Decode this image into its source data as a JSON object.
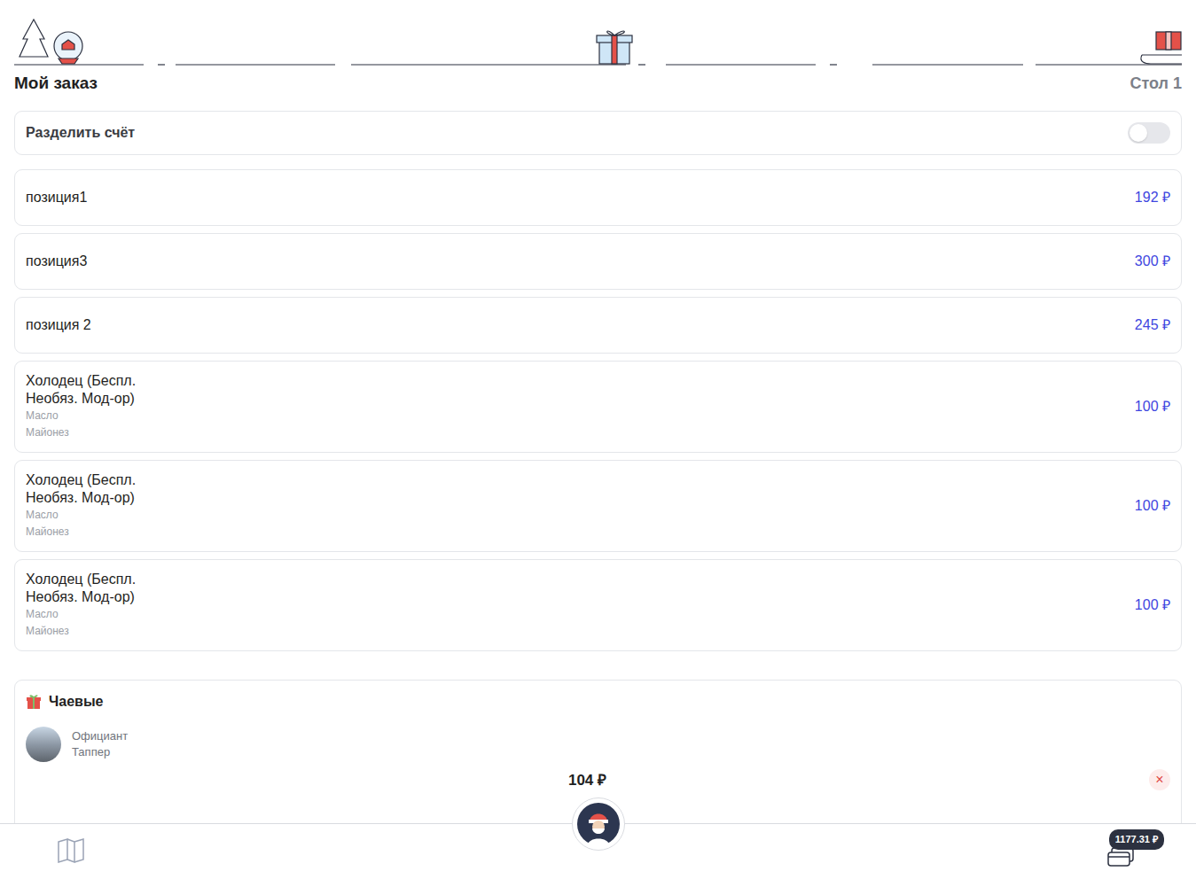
{
  "header": {
    "title": "Мой заказ",
    "table": "Стол 1"
  },
  "split": {
    "label": "Разделить счёт",
    "on": false
  },
  "items": [
    {
      "name": "позиция1",
      "price": "192 ₽",
      "modifiers": []
    },
    {
      "name": "позиция3",
      "price": "300 ₽",
      "modifiers": []
    },
    {
      "name": "позиция 2",
      "price": "245 ₽",
      "modifiers": []
    },
    {
      "name": "Холодец (Беспл. Необяз. Мод-ор)",
      "price": "100 ₽",
      "modifiers": [
        "Масло",
        "Майонез"
      ]
    },
    {
      "name": "Холодец (Беспл. Необяз. Мод-ор)",
      "price": "100 ₽",
      "modifiers": [
        "Масло",
        "Майонез"
      ]
    },
    {
      "name": "Холодец (Беспл. Необяз. Мод-ор)",
      "price": "100 ₽",
      "modifiers": [
        "Масло",
        "Майонез"
      ]
    }
  ],
  "tips": {
    "title": "Чаевые",
    "role": "Официант",
    "waiter": "Таппер",
    "amount": "104 ₽",
    "close": "×"
  },
  "bottom_bar": {
    "total": "1177.31 ₽"
  }
}
